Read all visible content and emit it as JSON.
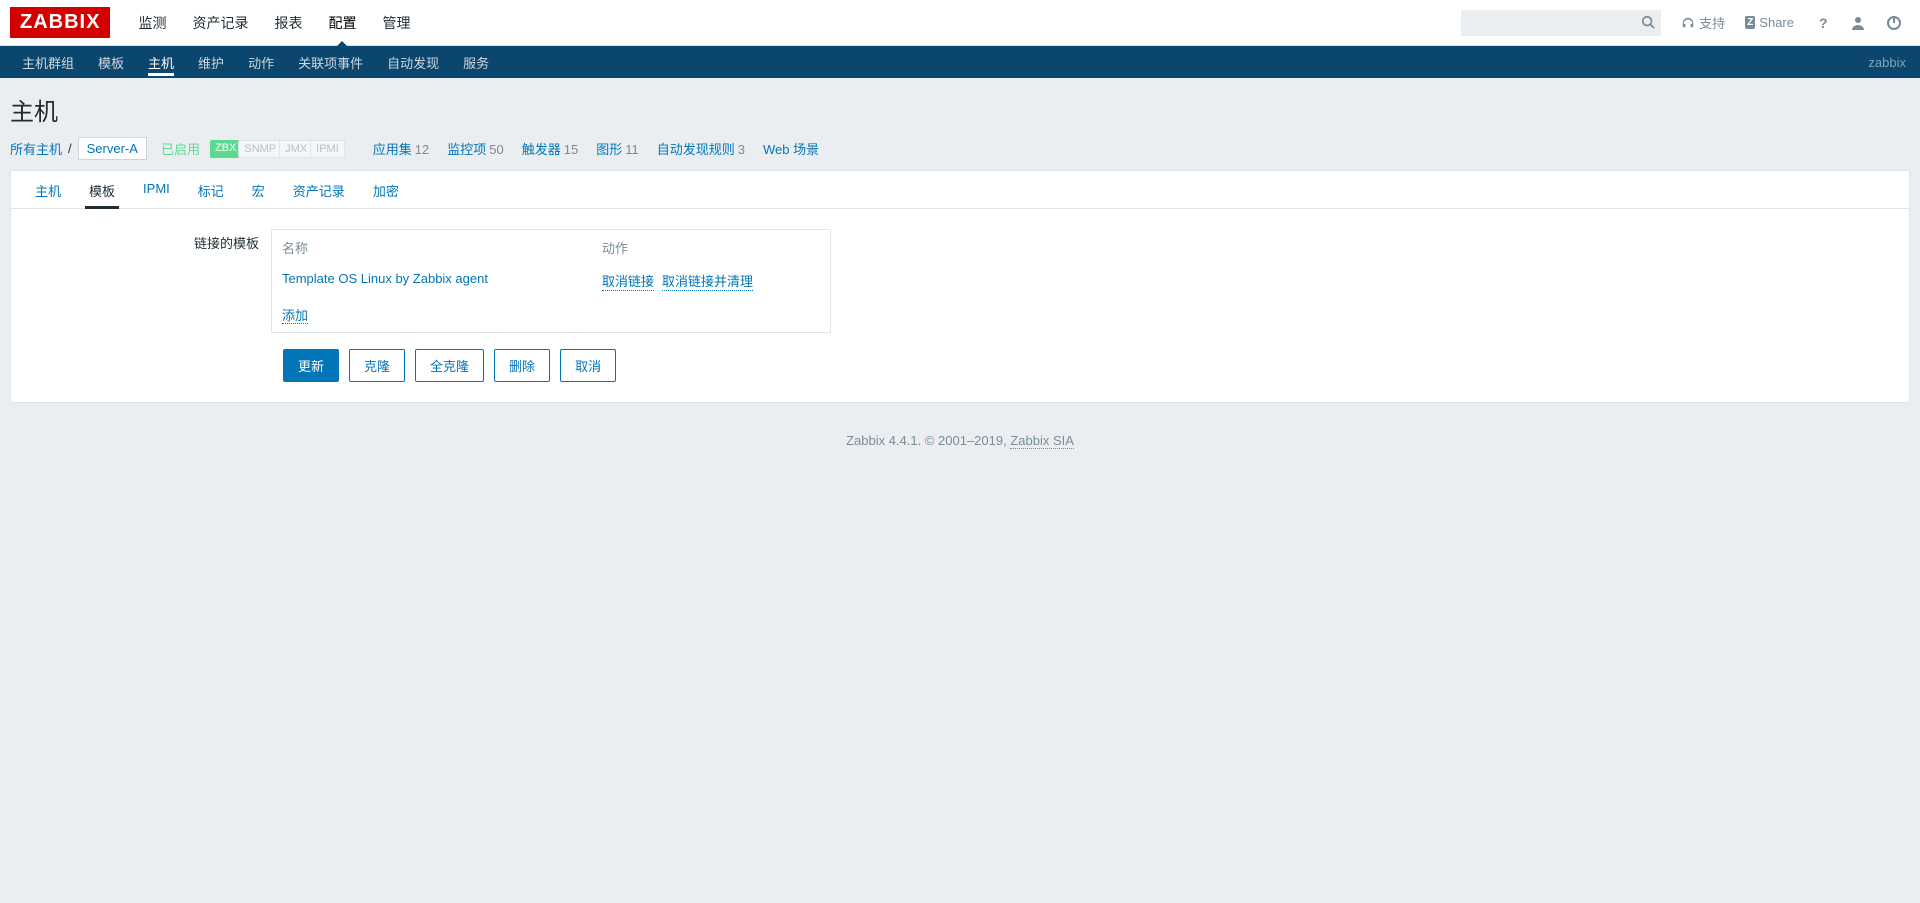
{
  "logo": "ZABBIX",
  "top_menu": [
    "监测",
    "资产记录",
    "报表",
    "配置",
    "管理"
  ],
  "top_menu_active": 3,
  "top_right": {
    "support": "支持",
    "share": "Share"
  },
  "sub_menu": [
    "主机群组",
    "模板",
    "主机",
    "维护",
    "动作",
    "关联项事件",
    "自动发现",
    "服务"
  ],
  "sub_menu_active": 2,
  "sub_right": "zabbix",
  "page_title": "主机",
  "breadcrumb": {
    "all_hosts": "所有主机",
    "host": "Server-A"
  },
  "status_enabled": "已启用",
  "interfaces": {
    "zbx": "ZBX",
    "snmp": "SNMP",
    "jmx": "JMX",
    "ipmi": "IPMI"
  },
  "filter_links": [
    {
      "label": "应用集",
      "count": "12"
    },
    {
      "label": "监控项",
      "count": "50"
    },
    {
      "label": "触发器",
      "count": "15"
    },
    {
      "label": "图形",
      "count": "11"
    },
    {
      "label": "自动发现规则",
      "count": "3"
    },
    {
      "label": "Web 场景",
      "count": ""
    }
  ],
  "tabs": [
    "主机",
    "模板",
    "IPMI",
    "标记",
    "宏",
    "资产记录",
    "加密"
  ],
  "tabs_active": 1,
  "form": {
    "label_linked": "链接的模板",
    "th_name": "名称",
    "th_action": "动作",
    "template_name": "Template OS Linux by Zabbix agent",
    "action_unlink": "取消链接",
    "action_unlink_clear": "取消链接并清理",
    "add": "添加"
  },
  "buttons": {
    "update": "更新",
    "clone": "克隆",
    "full_clone": "全克隆",
    "delete": "删除",
    "cancel": "取消"
  },
  "footer": {
    "text": "Zabbix 4.4.1. © 2001–2019, ",
    "link": "Zabbix SIA"
  }
}
